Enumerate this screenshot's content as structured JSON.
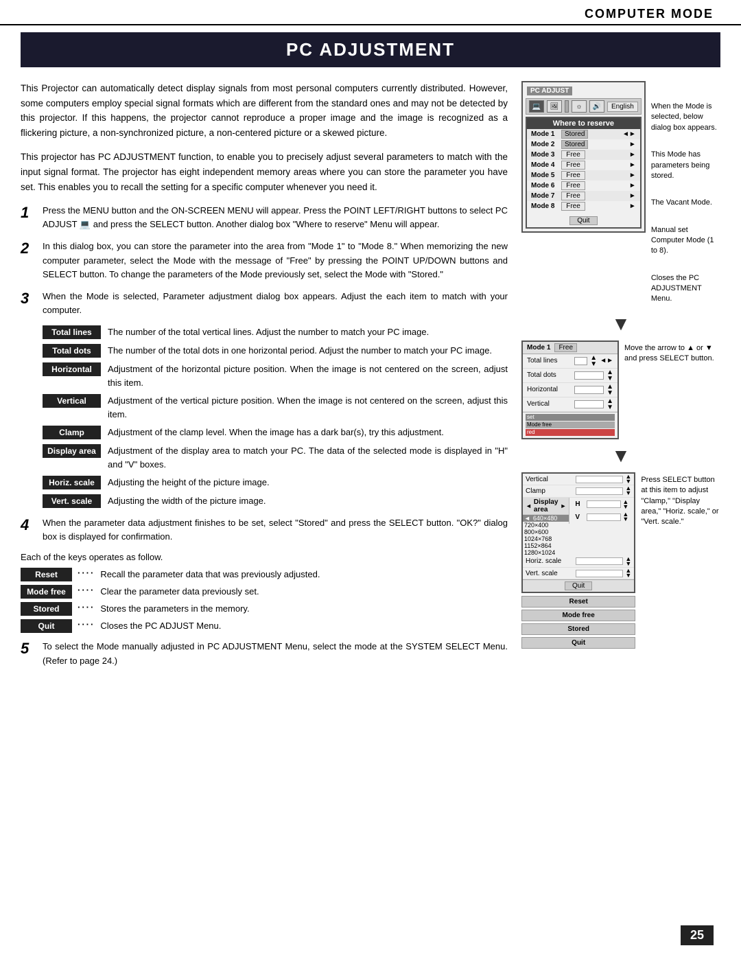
{
  "header": {
    "title": "COMPUTER MODE"
  },
  "page_title": "PC ADJUSTMENT",
  "intro": {
    "para1": "This Projector can automatically detect display signals from most personal computers currently distributed. However, some computers employ special signal formats which are different from the standard ones and may not be detected by this projector.  If this happens, the projector cannot reproduce a proper image and the image is recognized as a flickering picture, a non-synchronized picture, a non-centered picture or a skewed picture.",
    "para2": "This projector has PC ADJUSTMENT function, to enable you to precisely adjust several parameters to match with the input signal format.  The projector has eight independent memory areas where you can store the parameter you have set.  This enables you to recall the setting for a specific computer whenever you need it."
  },
  "steps": [
    {
      "num": "1",
      "text": "Press the MENU button and the ON-SCREEN MENU will appear. Press the POINT LEFT/RIGHT buttons to select PC ADJUST  and press the SELECT button.  Another dialog box \"Where to reserve\" Menu will appear."
    },
    {
      "num": "2",
      "text": "In this dialog box, you can store the parameter into the area from \"Mode 1\" to \"Mode 8.\"  When memorizing the new computer parameter, select the Mode with the message of \"Free\" by pressing the POINT UP/DOWN buttons and SELECT button.  To change the parameters of the Mode previously set, select the Mode with \"Stored.\""
    },
    {
      "num": "3",
      "text": "When the Mode is selected, Parameter adjustment dialog box appears.  Adjust the each item to match with  your computer."
    }
  ],
  "terms": [
    {
      "label": "Total lines",
      "desc": "The number of the total vertical lines.  Adjust the number to match your PC image."
    },
    {
      "label": "Total dots",
      "desc": "The number of the total dots in one horizontal period.  Adjust the number to match your PC image."
    },
    {
      "label": "Horizontal",
      "desc": "Adjustment of the horizontal picture position.  When the image is not centered on the screen, adjust this item."
    },
    {
      "label": "Vertical",
      "desc": "Adjustment of the vertical picture position.  When the image is not centered on the screen, adjust this item."
    },
    {
      "label": "Clamp",
      "desc": "Adjustment of the clamp level.  When the image has a dark bar(s), try this adjustment."
    },
    {
      "label": "Display area",
      "desc": "Adjustment of the display area to match your PC.  The data of the selected mode is displayed in \"H\" and \"V\" boxes."
    },
    {
      "label": "Horiz. scale",
      "desc": "Adjusting the height of the picture image."
    },
    {
      "label": "Vert. scale",
      "desc": "Adjusting the width of the picture image."
    }
  ],
  "step4": {
    "num": "4",
    "text": "When the parameter data adjustment finishes to be set, select \"Stored\" and press the SELECT button.  \"OK?\" dialog box is displayed for confirmation."
  },
  "key_ops_label": "Each of the keys operates as follow.",
  "keys": [
    {
      "label": "Reset",
      "dots": "····",
      "desc": "Recall the parameter data that was previously adjusted."
    },
    {
      "label": "Mode free",
      "dots": "····",
      "desc": "Clear the parameter data previously set."
    },
    {
      "label": "Stored",
      "dots": "····",
      "desc": "Stores the parameters in the memory."
    },
    {
      "label": "Quit",
      "dots": "····",
      "desc": "Closes the PC ADJUST Menu."
    }
  ],
  "step5": {
    "num": "5",
    "text": "To select the Mode manually adjusted in PC ADJUSTMENT Menu, select the mode at the SYSTEM SELECT Menu.  (Refer to page 24.)"
  },
  "page_number": "25",
  "ui": {
    "pc_adjust_label": "PC ADJUST",
    "english_label": "English",
    "where_to_reserve": "Where to reserve",
    "modes": [
      {
        "num": "Mode 1",
        "status": "Stored"
      },
      {
        "num": "Mode 2",
        "status": "Stored"
      },
      {
        "num": "Mode 3",
        "status": "Free"
      },
      {
        "num": "Mode 4",
        "status": "Free"
      },
      {
        "num": "Mode 5",
        "status": "Free"
      },
      {
        "num": "Mode 6",
        "status": "Free"
      },
      {
        "num": "Mode 7",
        "status": "Free"
      },
      {
        "num": "Mode 8",
        "status": "Free"
      }
    ],
    "quit_label": "Quit",
    "annotations": {
      "when_mode_selected": "When the Mode is selected,  below dialog box appears.",
      "this_mode_has": "This Mode has parameters being stored.",
      "vacant_mode": "The Vacant Mode.",
      "manual_set": "Manual set Computer Mode (1 to 8).",
      "closes_pc": "Closes the PC ADJUSTMENT Menu."
    },
    "param_box": {
      "mode_label": "Mode 1",
      "mode_status": "Free",
      "params": [
        "Total lines",
        "Total dots",
        "Horizontal",
        "Vertical"
      ]
    },
    "move_arrow_note": "Move the arrow to ▲ or ▼ and press SELECT button.",
    "press_select_note": "Press SELECT button at this item to adjust \"Clamp,\" \"Display area,\" \"Horiz. scale,\" or \"Vert. scale.\"",
    "options_box": {
      "vertical_label": "Vertical",
      "clamp_label": "Clamp",
      "display_area_label": "Display area",
      "resolutions": [
        "640×480",
        "720×400",
        "800×600",
        "1024×768",
        "1152×864",
        "1280×1024"
      ],
      "h_label": "H",
      "v_label": "V",
      "horiz_scale_label": "Horiz. scale",
      "vert_scale_label": "Vert. scale",
      "quit_label": "Quit"
    },
    "action_buttons": [
      "Reset",
      "Mode free",
      "Stored",
      "Quit"
    ]
  }
}
